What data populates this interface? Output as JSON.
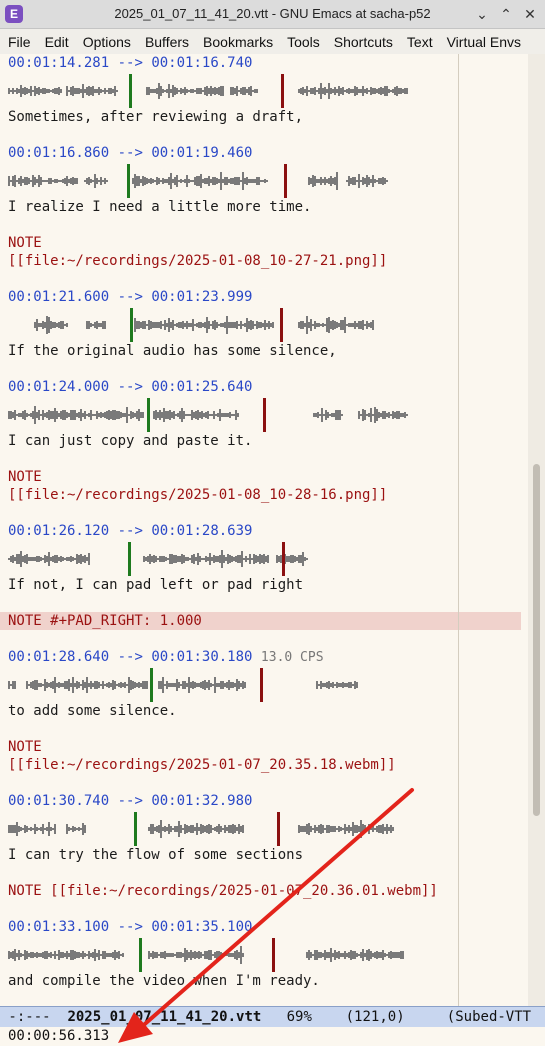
{
  "window": {
    "title": "2025_01_07_11_41_20.vtt - GNU Emacs at sacha-p52",
    "app_icon_glyph": "E",
    "buttons": {
      "minimize": "⌄",
      "maximize": "⌃",
      "close": "✕"
    }
  },
  "menu": [
    "File",
    "Edit",
    "Options",
    "Buffers",
    "Bookmarks",
    "Tools",
    "Shortcuts",
    "Text",
    "Virtual Envs"
  ],
  "cues": [
    {
      "start": "00:01:14.281",
      "end": "00:01:16.740",
      "text": "Sometimes, after reviewing a draft,"
    },
    {
      "start": "00:01:16.860",
      "end": "00:01:19.460",
      "text": "I realize I need a little more time."
    },
    {
      "start": "00:01:21.600",
      "end": "00:01:23.999",
      "text": "If the original audio has some silence,"
    },
    {
      "start": "00:01:24.000",
      "end": "00:01:25.640",
      "text": "I can just copy and paste it."
    },
    {
      "start": "00:01:26.120",
      "end": "00:01:28.639",
      "text": "If not, I can pad left or pad right"
    },
    {
      "start": "00:01:28.640",
      "end": "00:01:30.180",
      "cps": "13.0 CPS",
      "text": "to add some silence."
    },
    {
      "start": "00:01:30.740",
      "end": "00:01:32.980",
      "text": "I can try the flow of some sections"
    },
    {
      "start": "00:01:33.100",
      "end": "00:01:35.100",
      "text": "and compile the video when I'm ready."
    }
  ],
  "cue_arrow": "-->",
  "notes": {
    "n1_label": "NOTE",
    "n1_link": "[[file:~/recordings/2025-01-08_10-27-21.png]]",
    "n2_label": "NOTE",
    "n2_link": "[[file:~/recordings/2025-01-08_10-28-16.png]]",
    "n3": "NOTE #+PAD_RIGHT: 1.000",
    "n4_label": "NOTE",
    "n4_link": "[[file:~/recordings/2025-01-07_20.35.18.webm]]",
    "n5": "NOTE [[file:~/recordings/2025-01-07_20.36.01.webm]]"
  },
  "modeline": {
    "status": " -:---  ",
    "buffer_name": "2025_01_07_11_41_20.vtt",
    "percent": "69%",
    "position": "(121,0)",
    "mode": "(Subed-VTT"
  },
  "echo_area": "00:00:56.313",
  "colors": {
    "start_marker": "#1e7a1e",
    "end_marker": "#8b1010",
    "annotation_arrow": "#e3241b"
  }
}
